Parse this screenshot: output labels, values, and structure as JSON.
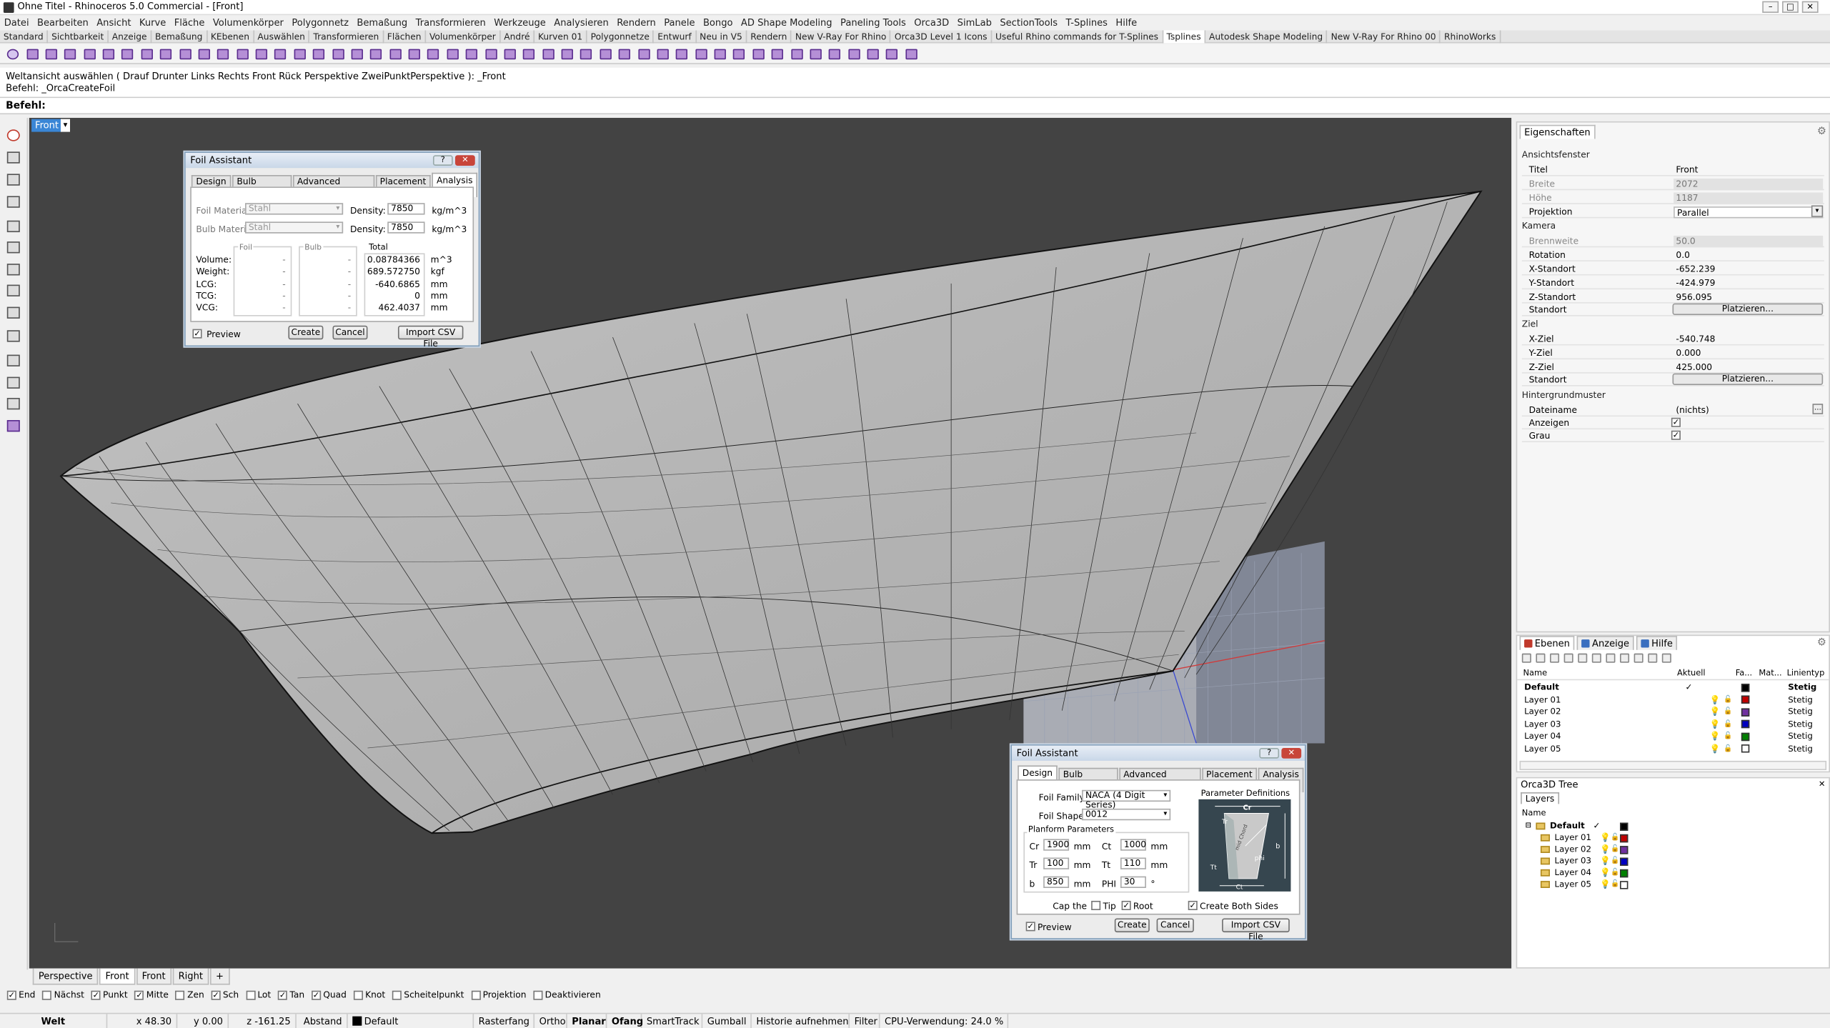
{
  "window": {
    "title": "Ohne Titel - Rhinoceros 5.0 Commercial - [Front]",
    "min": "–",
    "max": "□",
    "close": "✕"
  },
  "menu": [
    "Datei",
    "Bearbeiten",
    "Ansicht",
    "Kurve",
    "Fläche",
    "Volumenkörper",
    "Polygonnetz",
    "Bemaßung",
    "Transformieren",
    "Werkzeuge",
    "Analysieren",
    "Rendern",
    "Panele",
    "Bongo",
    "AD Shape Modeling",
    "Paneling Tools",
    "Orca3D",
    "SimLab",
    "SectionTools",
    "T-Splines",
    "Hilfe"
  ],
  "toolbar_tabs": [
    "Standard",
    "Sichtbarkeit",
    "Anzeige",
    "Bemaßung",
    "KEbenen",
    "Auswählen",
    "Transformieren",
    "Flächen",
    "Volumenkörper",
    "André",
    "Kurven 01",
    "Polygonnetze",
    "Entwurf",
    "Neu in V5",
    "Rendern",
    "New V-Ray For Rhino",
    "Orca3D Level 1 Icons",
    "Useful Rhino commands for T-Splines",
    "Tsplines",
    "Autodesk Shape Modeling",
    "New V-Ray For Rhino 00",
    "RhinoWorks"
  ],
  "toolbar_tabs_active": "Tsplines",
  "command": {
    "history1": "Weltansicht auswählen ( Drauf  Drunter  Links  Rechts  Front  Rück  Perspektive  ZweiPunktPerspektive ): _Front",
    "history2": "Befehl: _OrcaCreateFoil",
    "prompt": "Befehl:"
  },
  "viewport": {
    "label": "Front",
    "tabs": [
      "Perspective",
      "Front",
      "Front",
      "Right"
    ],
    "add_tab": "+",
    "active_tab_index": 1,
    "background": "#434343"
  },
  "osnaps": [
    {
      "label": "End",
      "checked": true
    },
    {
      "label": "Nächst",
      "checked": false
    },
    {
      "label": "Punkt",
      "checked": true
    },
    {
      "label": "Mitte",
      "checked": true
    },
    {
      "label": "Zen",
      "checked": false
    },
    {
      "label": "Sch",
      "checked": true
    },
    {
      "label": "Lot",
      "checked": false
    },
    {
      "label": "Tan",
      "checked": true
    },
    {
      "label": "Quad",
      "checked": true
    },
    {
      "label": "Knot",
      "checked": false
    },
    {
      "label": "Scheitelpunkt",
      "checked": false
    },
    {
      "label": "Projektion",
      "checked": false
    },
    {
      "label": "Deaktivieren",
      "checked": false
    }
  ],
  "status": {
    "cplane": "Welt",
    "x": "x 48.30",
    "y": "y 0.00",
    "z": "z -161.25",
    "distance": "Abstand",
    "layer": "Default",
    "grid": "Rasterfang",
    "ortho": "Ortho",
    "planar": "Planar",
    "osnap": "Ofang",
    "smarttrack": "SmartTrack",
    "gumball": "Gumball",
    "history": "Historie aufnehmen",
    "filter": "Filter",
    "cpu": "CPU-Verwendung: 24.0 %"
  },
  "foil_top": {
    "title": "Foil Assistant",
    "help": "?",
    "close": "✕",
    "tabs": [
      "Design",
      "Bulb Design",
      "Advanced Design",
      "Placement",
      "Analysis"
    ],
    "active_tab": "Analysis",
    "foil_material_label": "Foil Material",
    "foil_material": "Stahl",
    "bulb_material_label": "Bulb Material",
    "bulb_material": "Stahl",
    "density_label": "Density:",
    "density1": "7850",
    "density2": "7850",
    "density_unit": "kg/m^3",
    "col_foil": "Foil",
    "col_bulb": "Bulb",
    "col_total": "Total",
    "rows": [
      {
        "label": "Volume:",
        "foil": "-",
        "bulb": "-",
        "total": "0.08784366",
        "unit": "m^3"
      },
      {
        "label": "Weight:",
        "foil": "-",
        "bulb": "-",
        "total": "689.572750",
        "unit": "kgf"
      },
      {
        "label": "LCG:",
        "foil": "-",
        "bulb": "-",
        "total": "-640.6865",
        "unit": "mm"
      },
      {
        "label": "TCG:",
        "foil": "-",
        "bulb": "-",
        "total": "0",
        "unit": "mm"
      },
      {
        "label": "VCG:",
        "foil": "-",
        "bulb": "-",
        "total": "462.4037",
        "unit": "mm"
      }
    ],
    "preview": "Preview",
    "preview_checked": true,
    "create": "Create",
    "cancel": "Cancel",
    "import": "Import CSV File"
  },
  "foil_bottom": {
    "title": "Foil Assistant",
    "help": "?",
    "close": "✕",
    "tabs": [
      "Design",
      "Bulb Design",
      "Advanced Design",
      "Placement",
      "Analysis"
    ],
    "active_tab": "Design",
    "family_label": "Foil Family",
    "family": "NACA (4 Digit Series)",
    "shape_label": "Foil Shape",
    "shape": "0012",
    "planform": "Planform Parameters",
    "params": [
      {
        "k": "Cr",
        "v": "1900",
        "u": "mm",
        "k2": "Ct",
        "v2": "1000",
        "u2": "mm"
      },
      {
        "k": "Tr",
        "v": "100",
        "u": "mm",
        "k2": "Tt",
        "v2": "110",
        "u2": "mm"
      },
      {
        "k": "b",
        "v": "850",
        "u": "mm",
        "k2": "PHI",
        "v2": "30",
        "u2": "°"
      }
    ],
    "cap_label": "Cap the",
    "tip": "Tip",
    "tip_checked": false,
    "root": "Root",
    "root_checked": true,
    "both_sides": "Create Both Sides",
    "both_checked": true,
    "param_def": "Parameter Definitions",
    "diagram_labels": {
      "cr": "Cr",
      "tr": "Tr",
      "b": "b",
      "phi": "phi",
      "tt": "Tt",
      "ct": "Ct",
      "mid": "mid Chord"
    },
    "preview": "Preview",
    "preview_checked": true,
    "create": "Create",
    "cancel": "Cancel",
    "import": "Import CSV File"
  },
  "properties": {
    "tab": "Eigenschaften",
    "section_view": "Ansichtsfenster",
    "title_k": "Titel",
    "title_v": "Front",
    "width_k": "Breite",
    "width_v": "2072",
    "height_k": "Höhe",
    "height_v": "1187",
    "proj_k": "Projektion",
    "proj_v": "Parallel",
    "section_cam": "Kamera",
    "focal_k": "Brennweite",
    "focal_v": "50.0",
    "rot_k": "Rotation",
    "rot_v": "0.0",
    "xs_k": "X-Standort",
    "xs_v": "-652.239",
    "ys_k": "Y-Standort",
    "ys_v": "-424.979",
    "zs_k": "Z-Standort",
    "zs_v": "956.095",
    "loc_k": "Standort",
    "place": "Platzieren...",
    "section_target": "Ziel",
    "xt_k": "X-Ziel",
    "xt_v": "-540.748",
    "yt_k": "Y-Ziel",
    "yt_v": "0.000",
    "zt_k": "Z-Ziel",
    "zt_v": "425.000",
    "loc2_k": "Standort",
    "section_bg": "Hintergrundmuster",
    "file_k": "Dateiname",
    "file_v": "(nichts)",
    "show_k": "Anzeigen",
    "gray_k": "Grau"
  },
  "layers": {
    "tabs": [
      "Ebenen",
      "Anzeige",
      "Hilfe"
    ],
    "cols": {
      "name": "Name",
      "current": "Aktuell",
      "color": "Fa...",
      "mat": "Mat...",
      "ltype": "Linientyp"
    },
    "rows": [
      {
        "name": "Default",
        "current": "✓",
        "color": "#000000",
        "ltype": "Stetig",
        "bold": true
      },
      {
        "name": "Layer 01",
        "current": "",
        "color": "#c00000",
        "ltype": "Stetig"
      },
      {
        "name": "Layer 02",
        "current": "",
        "color": "#7030a0",
        "ltype": "Stetig"
      },
      {
        "name": "Layer 03",
        "current": "",
        "color": "#0000c0",
        "ltype": "Stetig"
      },
      {
        "name": "Layer 04",
        "current": "",
        "color": "#008000",
        "ltype": "Stetig"
      },
      {
        "name": "Layer 05",
        "current": "",
        "color": "#ffffff",
        "ltype": "Stetig"
      }
    ]
  },
  "orca_tree": {
    "title": "Orca3D Tree",
    "tab": "Layers",
    "col_name": "Name",
    "rows": [
      {
        "name": "Default",
        "color": "#000000",
        "bold": true,
        "check": "✓"
      },
      {
        "name": "Layer 01",
        "color": "#c00000"
      },
      {
        "name": "Layer 02",
        "color": "#7030a0"
      },
      {
        "name": "Layer 03",
        "color": "#0000c0"
      },
      {
        "name": "Layer 04",
        "color": "#008000"
      },
      {
        "name": "Layer 05",
        "color": "#ffffff"
      }
    ]
  }
}
